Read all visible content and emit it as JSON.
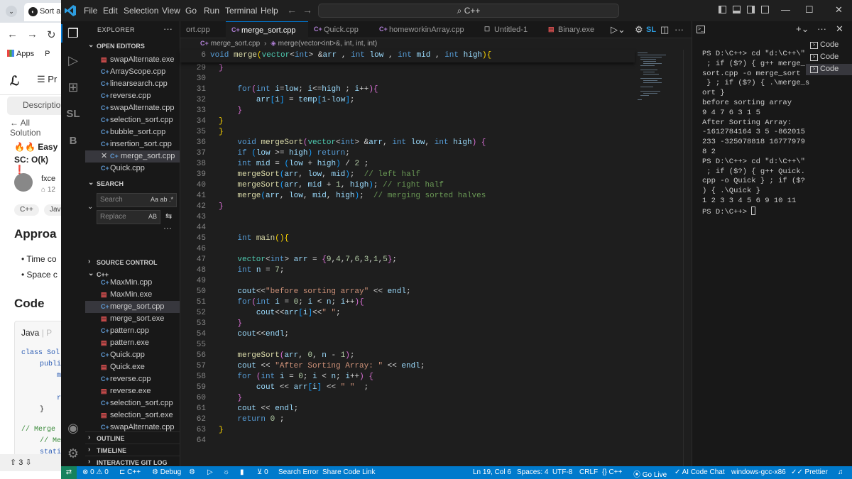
{
  "browser": {
    "tab_title": "Sort ar",
    "bookmarks_apps": "Apps",
    "bookmarks_next": "P",
    "leetcode": {
      "menu_label": "Pr",
      "description_tab": "Description",
      "all_solutions": "All Solution",
      "title_fragment": "🔥🔥 Easy",
      "sc_fragment": "SC: O(k) ❗",
      "author": "fxce",
      "rep": "12",
      "pill_cpp": "C++",
      "pill_java": "Jav",
      "approach_heading": "Approa",
      "bullet_time": "Time co",
      "bullet_space": "Space c",
      "code_heading": "Code",
      "code_tab": "Java",
      "code_tab_next": "P",
      "code_lines": [
        "class Sol",
        "publi",
        "m",
        "r",
        "}",
        "// Merge",
        "// Me",
        "stati"
      ],
      "upvotes": "3"
    }
  },
  "vscode": {
    "menu": [
      "File",
      "Edit",
      "Selection",
      "View",
      "Go",
      "Run",
      "Terminal",
      "Help"
    ],
    "command_center": "C++",
    "explorer_title": "EXPLORER",
    "open_editors_title": "OPEN EDITORS",
    "open_editors": [
      {
        "name": "swapAlternate.exe",
        "type": "exe"
      },
      {
        "name": "ArrayScope.cpp",
        "type": "cpp"
      },
      {
        "name": "linearsearch.cpp",
        "type": "cpp"
      },
      {
        "name": "reverse.cpp",
        "type": "cpp"
      },
      {
        "name": "swapAlternate.cpp",
        "type": "cpp"
      },
      {
        "name": "selection_sort.cpp",
        "type": "cpp"
      },
      {
        "name": "bubble_sort.cpp",
        "type": "cpp"
      },
      {
        "name": "insertion_sort.cpp",
        "type": "cpp"
      },
      {
        "name": "merge_sort.cpp",
        "type": "cpp",
        "active": true
      },
      {
        "name": "Quick.cpp",
        "type": "cpp"
      }
    ],
    "search_title": "SEARCH",
    "search_placeholder": "Search",
    "search_opts": "Aa ab .*",
    "replace_placeholder": "Replace",
    "replace_opts": "AB",
    "source_control_title": "SOURCE CONTROL",
    "folder_title": "C++",
    "folder_files": [
      {
        "name": "MaxMin.cpp",
        "type": "cpp"
      },
      {
        "name": "MaxMin.exe",
        "type": "exe"
      },
      {
        "name": "merge_sort.cpp",
        "type": "cpp",
        "active": true
      },
      {
        "name": "merge_sort.exe",
        "type": "exe"
      },
      {
        "name": "pattern.cpp",
        "type": "cpp"
      },
      {
        "name": "pattern.exe",
        "type": "exe"
      },
      {
        "name": "Quick.cpp",
        "type": "cpp"
      },
      {
        "name": "Quick.exe",
        "type": "exe"
      },
      {
        "name": "reverse.cpp",
        "type": "cpp"
      },
      {
        "name": "reverse.exe",
        "type": "exe"
      },
      {
        "name": "selection_sort.cpp",
        "type": "cpp"
      },
      {
        "name": "selection_sort.exe",
        "type": "exe"
      },
      {
        "name": "swapAlternate.cpp",
        "type": "cpp"
      }
    ],
    "outline_title": "OUTLINE",
    "timeline_title": "TIMELINE",
    "git_log_title": "INTERACTIVE GIT LOG",
    "tabs": [
      {
        "label": "ort.cpp",
        "type": "cpp"
      },
      {
        "label": "merge_sort.cpp",
        "type": "cpp",
        "active": true
      },
      {
        "label": "Quick.cpp",
        "type": "cpp"
      },
      {
        "label": "homeworkinArray.cpp",
        "type": "cpp"
      },
      {
        "label": "Untitled-1",
        "type": "txt"
      },
      {
        "label": "Binary.exe",
        "type": "exe"
      }
    ],
    "breadcrumb": {
      "file": "merge_sort.cpp",
      "symbol": "merge(vector<int>&, int, int, int)"
    },
    "sticky_line_no": "6",
    "line_numbers": [
      "29",
      "30",
      "31",
      "32",
      "33",
      "34",
      "35",
      "36",
      "37",
      "38",
      "39",
      "40",
      "41",
      "42",
      "43",
      "44",
      "45",
      "46",
      "47",
      "48",
      "49",
      "50",
      "51",
      "52",
      "53",
      "54",
      "55",
      "56",
      "57",
      "58",
      "59",
      "60",
      "61",
      "62",
      "63",
      "64"
    ],
    "terminal": {
      "output": "PS D:\\C++> cd \"d:\\C++\\\"\n ; if ($?) { g++ merge_\nsort.cpp -o merge_sort\n } ; if ($?) { .\\merge_s\nort }\nbefore sorting array\n9 4 7 6 3 1 5\nAfter Sorting Array: \n-1612784164 3 5 -862015\n233 -325078818 16777979\n8 2\nPS D:\\C++> cd \"d:\\C++\\\"\n ; if ($?) { g++ Quick.\ncpp -o Quick } ; if ($?\n) { .\\Quick }\n1 2 3 3 4 5 6 9 10 11\nPS D:\\C++> ",
      "instances": [
        "Code",
        "Code",
        "Code"
      ]
    },
    "statusbar": {
      "problems": "⊗ 0 ⚠ 0",
      "lang_chip": "C++",
      "debug": "Debug",
      "ports": "0",
      "search_error": "Search Error",
      "share": "Share Code Link",
      "position": "Ln 19, Col 6",
      "spaces": "Spaces: 4",
      "encoding": "UTF-8",
      "eol": "CRLF",
      "language": "{} C++",
      "go_live": "Go Live",
      "ai": "AI Code Chat",
      "compiler": "windows-gcc-x86",
      "prettier": "Prettier"
    }
  }
}
